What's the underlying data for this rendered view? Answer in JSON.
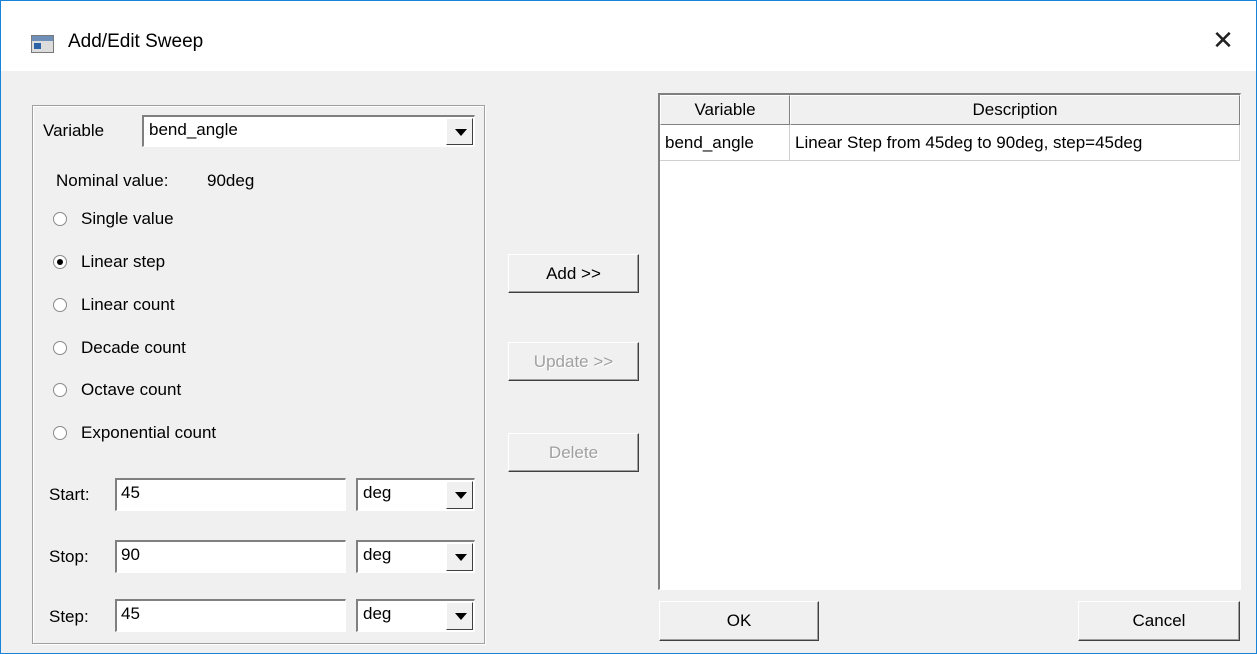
{
  "window": {
    "title": "Add/Edit Sweep",
    "close_glyph": "✕"
  },
  "left_panel": {
    "variable_label": "Variable",
    "variable_value": "bend_angle",
    "nominal_label": "Nominal value:",
    "nominal_value": "90deg",
    "sweep_types": [
      {
        "label": "Single value",
        "checked": false
      },
      {
        "label": "Linear step",
        "checked": true
      },
      {
        "label": "Linear count",
        "checked": false
      },
      {
        "label": "Decade count",
        "checked": false
      },
      {
        "label": "Octave count",
        "checked": false
      },
      {
        "label": "Exponential count",
        "checked": false
      }
    ],
    "start": {
      "label": "Start:",
      "value": "45",
      "unit": "deg"
    },
    "stop": {
      "label": "Stop:",
      "value": "90",
      "unit": "deg"
    },
    "step": {
      "label": "Step:",
      "value": "45",
      "unit": "deg"
    }
  },
  "middle_buttons": {
    "add": "Add >>",
    "update": "Update >>",
    "delete": "Delete"
  },
  "sweep_table": {
    "columns": [
      "Variable",
      "Description"
    ],
    "rows": [
      [
        "bend_angle",
        "Linear Step from 45deg to 90deg, step=45deg"
      ]
    ]
  },
  "footer": {
    "ok": "OK",
    "cancel": "Cancel"
  }
}
